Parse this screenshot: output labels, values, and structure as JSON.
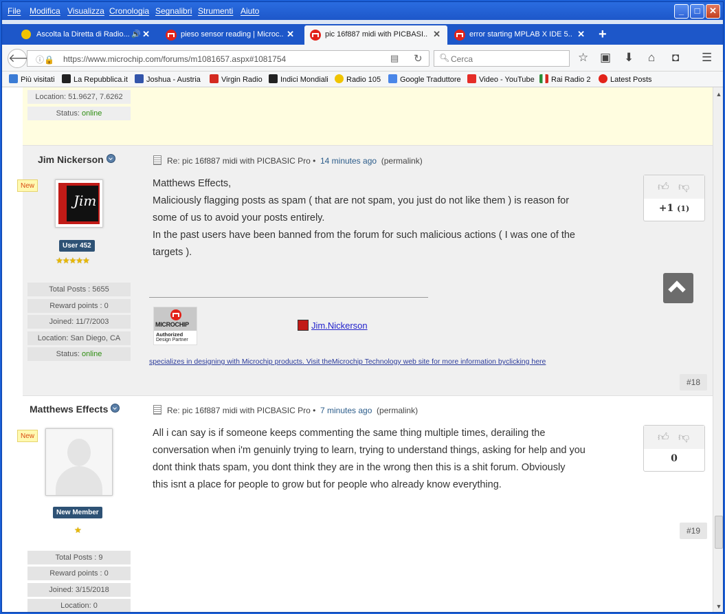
{
  "menu": [
    "File",
    "Modifica",
    "Visualizza",
    "Cronologia",
    "Segnalibri",
    "Strumenti",
    "Aiuto"
  ],
  "tabs": [
    {
      "label": "Ascolta la Diretta di Radio...",
      "icon": "radio105-icon",
      "sound": "🔊"
    },
    {
      "label": "pieso sensor reading | Microc...",
      "icon": "microchip-icon"
    },
    {
      "label": "pic 16f887 midi with PICBASI...",
      "icon": "microchip-icon"
    },
    {
      "label": "error starting MPLAB X IDE 5....",
      "icon": "microchip-icon"
    }
  ],
  "nav": {
    "url": "https://www.microchip.com/forums/m1081657.aspx#1081754",
    "search_placeholder": "Cerca"
  },
  "bookmarks": [
    {
      "label": "Più visitati",
      "color": "#3a7bd5"
    },
    {
      "label": "La Repubblica.it",
      "color": "#222222"
    },
    {
      "label": "Joshua - Austria",
      "color": "#3355aa"
    },
    {
      "label": "Virgin Radio",
      "color": "#d42a20"
    },
    {
      "label": "Indici Mondiali",
      "color": "#222222"
    },
    {
      "label": "Radio 105",
      "color": "#f0c400"
    },
    {
      "label": "Google Traduttore",
      "color": "#4a86e8"
    },
    {
      "label": "Video - YouTube",
      "color": "#e52d27"
    },
    {
      "label": "Rai Radio 2",
      "color": "#2a8f3a"
    },
    {
      "label": "Latest Posts",
      "color": "#e2231a"
    }
  ],
  "prev_post": {
    "location": "Location: 51.9627, 7.6262",
    "status_label": "Status: ",
    "status_value": "online"
  },
  "posts": [
    {
      "username": "Jim Nickerson",
      "new_badge": "New",
      "rank": "User 452",
      "stars": "★★★★★",
      "stats": [
        "Total Posts : 5655",
        "Reward points : 0",
        "Joined: 11/7/2003",
        "Location: San Diego, CA"
      ],
      "status_label": "Status: ",
      "status_value": "online",
      "title": "Re: pic 16f887 midi with PICBASIC Pro",
      "sep": "•",
      "ago": "14 minutes ago",
      "permalink": "(permalink)",
      "body": [
        "Matthews Effects,",
        "Maliciously flagging posts as spam ( that are not spam, you just do not like them ) is reason for",
        "some of us to avoid your posts entirely.",
        "In the past users have been banned from the forum for such malicious actions ( I was one of the",
        "targets )."
      ],
      "score": "+1",
      "score_count": "(1)",
      "number": "#18",
      "signature": {
        "logo_name": "MICROCHIP",
        "logo_line1": "Authorized",
        "logo_line2": "Design Partner",
        "link": "Jim.Nickerson",
        "text": "specializes in designing with Microchip products. Visit theMicrochip Technology web site for more information byclicking here"
      }
    },
    {
      "username": "Matthews Effects",
      "new_badge": "New",
      "rank": "New Member",
      "stars": "★",
      "stats": [
        "Total Posts : 9",
        "Reward points : 0",
        "Joined: 3/15/2018",
        "Location: 0"
      ],
      "title": "Re: pic 16f887 midi with PICBASIC Pro",
      "sep": "•",
      "ago": "7 minutes ago",
      "permalink": "(permalink)",
      "body": [
        "All i can say is if someone keeps commenting the same thing multiple times, derailing the",
        "conversation when i'm genuinly trying to learn, trying to understand things, asking for help and you",
        "dont think thats spam, you dont think they are in the wrong then this is a shit forum. Obviously",
        "this isnt a place for people to grow but for people who already know everything."
      ],
      "score": "0",
      "number": "#19"
    }
  ]
}
